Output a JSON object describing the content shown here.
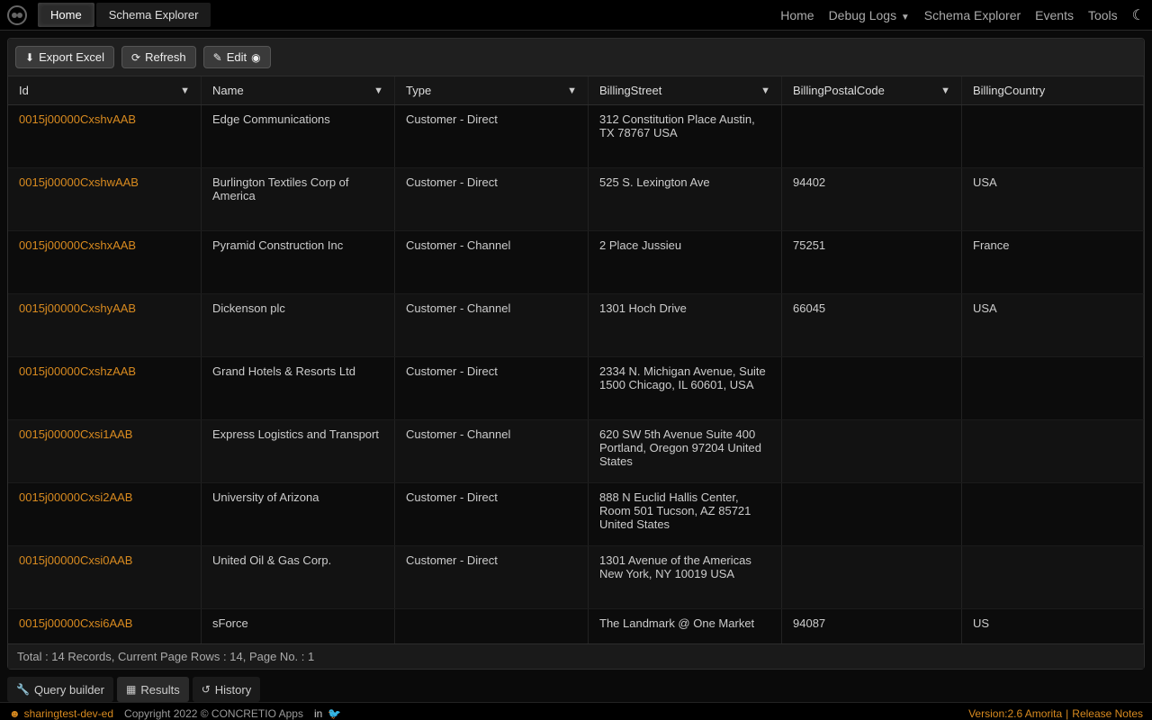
{
  "top_tabs": {
    "home": "Home",
    "schema": "Schema Explorer"
  },
  "nav": {
    "home": "Home",
    "debug": "Debug Logs",
    "schema": "Schema Explorer",
    "events": "Events",
    "tools": "Tools"
  },
  "toolbar": {
    "export": "Export Excel",
    "refresh": "Refresh",
    "edit": "Edit"
  },
  "columns": {
    "id": "Id",
    "name": "Name",
    "type": "Type",
    "street": "BillingStreet",
    "postal": "BillingPostalCode",
    "country": "BillingCountry"
  },
  "rows": [
    {
      "id": "0015j00000CxshvAAB",
      "name": "Edge Communications",
      "type": "Customer - Direct",
      "street": "312 Constitution Place Austin, TX 78767 USA",
      "postal": "",
      "country": ""
    },
    {
      "id": "0015j00000CxshwAAB",
      "name": "Burlington Textiles Corp of America",
      "type": "Customer - Direct",
      "street": "525 S. Lexington Ave",
      "postal": "94402",
      "country": "USA"
    },
    {
      "id": "0015j00000CxshxAAB",
      "name": "Pyramid Construction Inc",
      "type": "Customer - Channel",
      "street": "2 Place Jussieu",
      "postal": "75251",
      "country": "France"
    },
    {
      "id": "0015j00000CxshyAAB",
      "name": "Dickenson plc",
      "type": "Customer - Channel",
      "street": "1301 Hoch Drive",
      "postal": "66045",
      "country": "USA"
    },
    {
      "id": "0015j00000CxshzAAB",
      "name": "Grand Hotels & Resorts Ltd",
      "type": "Customer - Direct",
      "street": "2334 N. Michigan Avenue, Suite 1500 Chicago, IL 60601, USA",
      "postal": "",
      "country": ""
    },
    {
      "id": "0015j00000Cxsi1AAB",
      "name": "Express Logistics and Transport",
      "type": "Customer - Channel",
      "street": "620 SW 5th Avenue Suite 400 Portland, Oregon 97204 United States",
      "postal": "",
      "country": ""
    },
    {
      "id": "0015j00000Cxsi2AAB",
      "name": "University of Arizona",
      "type": "Customer - Direct",
      "street": "888 N Euclid Hallis Center, Room 501 Tucson, AZ 85721 United States",
      "postal": "",
      "country": ""
    },
    {
      "id": "0015j00000Cxsi0AAB",
      "name": "United Oil & Gas Corp.",
      "type": "Customer - Direct",
      "street": "1301 Avenue of the Americas New York, NY 10019 USA",
      "postal": "",
      "country": ""
    },
    {
      "id": "0015j00000Cxsi6AAB",
      "name": "sForce",
      "type": "",
      "street": "The Landmark @ One Market",
      "postal": "94087",
      "country": "US"
    }
  ],
  "status": "Total : 14 Records, Current Page Rows : 14, Page No. : 1",
  "bottom_tabs": {
    "query": "Query builder",
    "results": "Results",
    "history": "History"
  },
  "footer": {
    "org": "sharingtest-dev-ed",
    "copyright": "Copyright 2022 © CONCRETIO Apps",
    "version": "Version:2.6 Amorita",
    "release": "Release Notes"
  }
}
